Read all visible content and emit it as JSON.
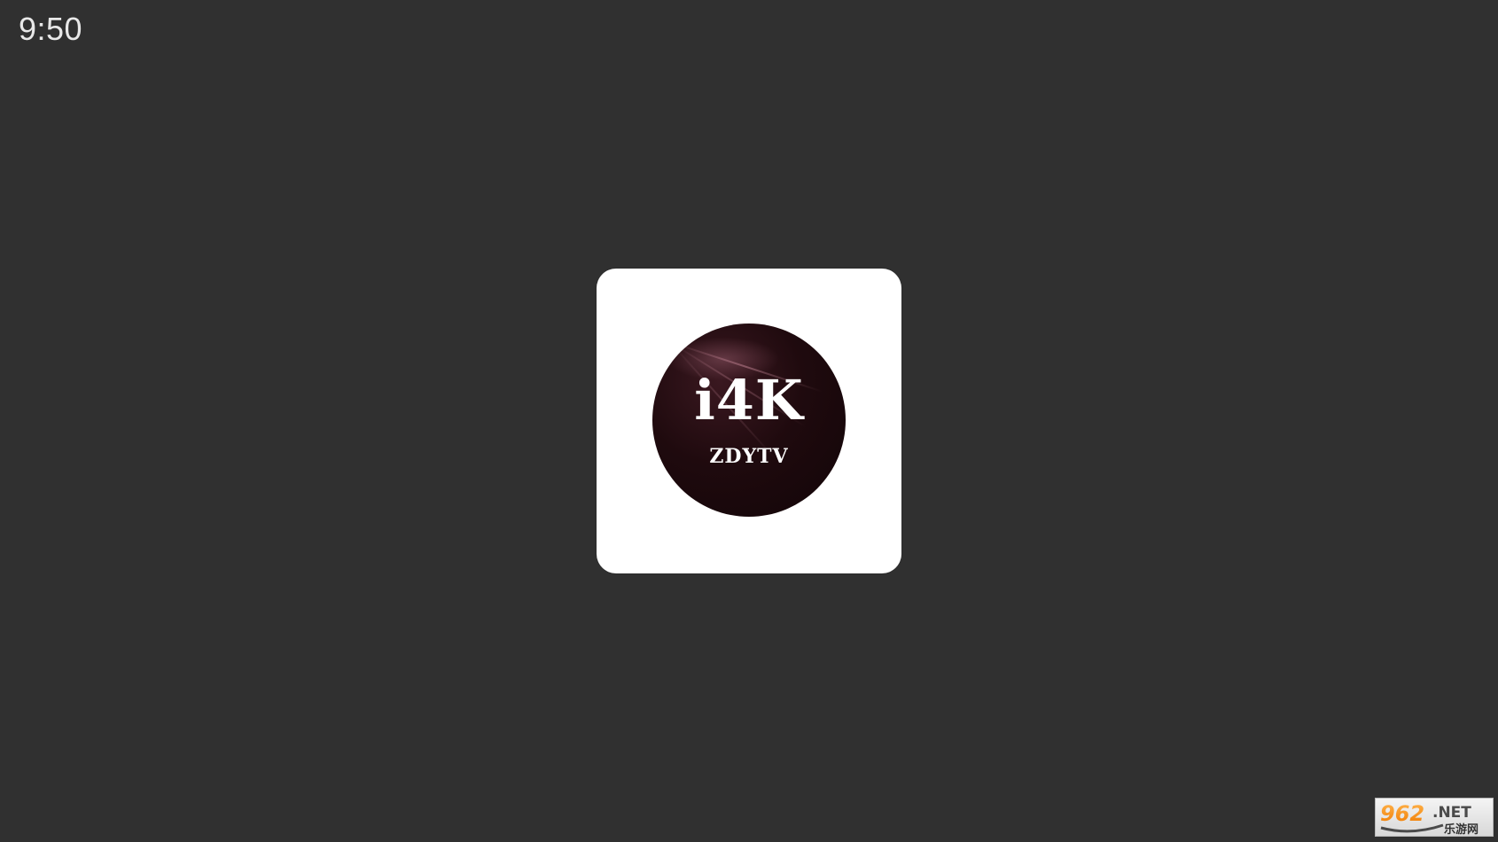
{
  "status_bar": {
    "time": "9:50"
  },
  "app_icon": {
    "title": "i4K",
    "subtitle": "ZDYTV"
  },
  "watermark": {
    "brand": "962.NET 乐游网"
  }
}
